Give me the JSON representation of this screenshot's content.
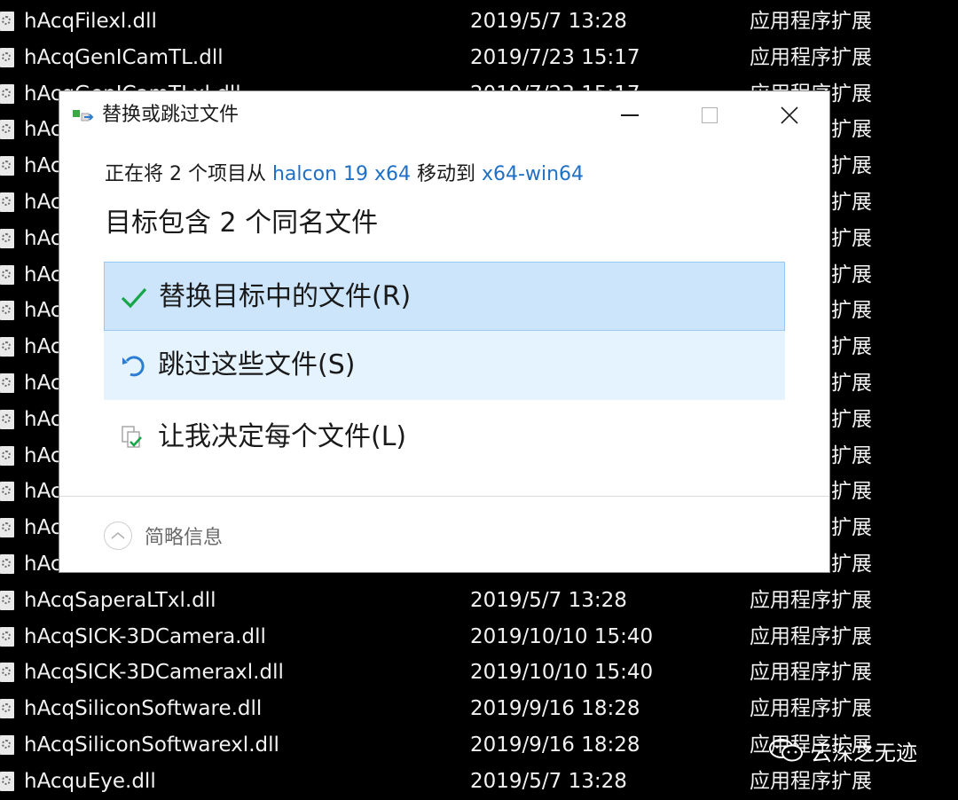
{
  "files": [
    {
      "name": "hAcqFilexl.dll",
      "date": "2019/5/7 13:28",
      "type": "应用程序扩展"
    },
    {
      "name": "hAcqGenICamTL.dll",
      "date": "2019/7/23 15:17",
      "type": "应用程序扩展"
    },
    {
      "name": "hAcqGenICamTLxl.dll",
      "date": "2019/7/23 15:17",
      "type": "应用程序扩展"
    },
    {
      "name": "hAc",
      "date": "",
      "type": "扩展"
    },
    {
      "name": "hAc",
      "date": "",
      "type": "扩展"
    },
    {
      "name": "hAc",
      "date": "",
      "type": "扩展"
    },
    {
      "name": "hAc",
      "date": "",
      "type": "扩展"
    },
    {
      "name": "hAc",
      "date": "",
      "type": "扩展"
    },
    {
      "name": "hAc",
      "date": "",
      "type": "扩展"
    },
    {
      "name": "hAc",
      "date": "",
      "type": "扩展"
    },
    {
      "name": "hAc",
      "date": "",
      "type": "扩展"
    },
    {
      "name": "hAc",
      "date": "",
      "type": "扩展"
    },
    {
      "name": "hAc",
      "date": "",
      "type": "扩展"
    },
    {
      "name": "hAc",
      "date": "",
      "type": "扩展"
    },
    {
      "name": "hAc",
      "date": "",
      "type": "扩展"
    },
    {
      "name": "hAc",
      "date": "",
      "type": "扩展"
    },
    {
      "name": "hAcqSaperaLTxl.dll",
      "date": "2019/5/7 13:28",
      "type": "应用程序扩展"
    },
    {
      "name": "hAcqSICK-3DCamera.dll",
      "date": "2019/10/10 15:40",
      "type": "应用程序扩展"
    },
    {
      "name": "hAcqSICK-3DCameraxl.dll",
      "date": "2019/10/10 15:40",
      "type": "应用程序扩展"
    },
    {
      "name": "hAcqSiliconSoftware.dll",
      "date": "2019/9/16 18:28",
      "type": "应用程序扩展"
    },
    {
      "name": "hAcqSiliconSoftwarexl.dll",
      "date": "2019/9/16 18:28",
      "type": "应用程序扩展"
    },
    {
      "name": "hAcquEye.dll",
      "date": "2019/5/7 13:28",
      "type": "应用程序扩展"
    }
  ],
  "dialog": {
    "title": "替换或跳过文件",
    "info_prefix": "正在将 2 个项目从 ",
    "source_folder": "halcon 19 x64",
    "info_middle": " 移动到 ",
    "dest_folder": "x64-win64",
    "heading": "目标包含 2 个同名文件",
    "options": {
      "replace": "替换目标中的文件(R)",
      "skip": "跳过这些文件(S)",
      "decide": "让我决定每个文件(L)"
    },
    "details_label": "简略信息"
  },
  "watermark": {
    "text": "云深之无迹"
  },
  "colors": {
    "link": "#1f6fc5",
    "replace_bg": "#cce5fb",
    "skip_bg": "#e5f3fe",
    "check": "#19a54a",
    "explorer_bg": "#000000"
  },
  "icons": {
    "app": "move-file-icon",
    "replace": "check-icon",
    "skip": "undo-icon",
    "decide": "compare-files-icon",
    "details": "chevron-up-icon"
  }
}
